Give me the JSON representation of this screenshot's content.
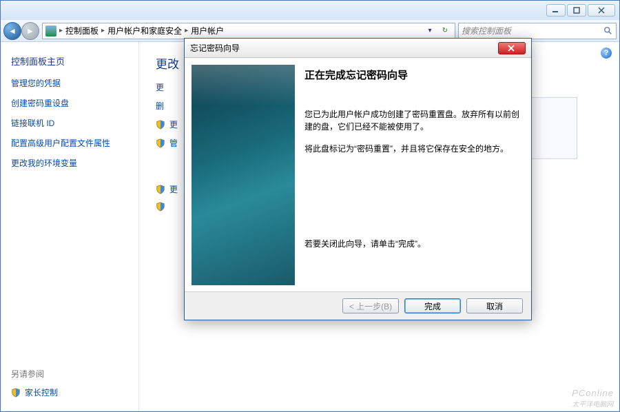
{
  "window": {
    "min_tip": "最小化",
    "max_tip": "最大化",
    "close_tip": "关闭"
  },
  "breadcrumb": {
    "root_icon": "control-panel-icon",
    "items": [
      "控制面板",
      "用户帐户和家庭安全",
      "用户帐户"
    ]
  },
  "search": {
    "placeholder": "搜索控制面板"
  },
  "sidebar": {
    "title": "控制面板主页",
    "links": [
      "管理您的凭据",
      "创建密码重设盘",
      "链接联机 ID",
      "配置高级用户配置文件属性",
      "更改我的环境变量"
    ],
    "see_also": "另请参阅",
    "parental": "家长控制"
  },
  "main": {
    "title_partial": "更改",
    "help_tip": "帮助",
    "items": [
      "更",
      "删",
      "更",
      "管",
      "更"
    ]
  },
  "wizard": {
    "window_title": "忘记密码向导",
    "heading": "正在完成忘记密码向导",
    "p1": "您已为此用户帐户成功创建了密码重置盘。放弃所有以前创建的盘，它们已经不能被使用了。",
    "p2": "将此盘标记为“密码重置”，并且将它保存在安全的地方。",
    "p_end": "若要关闭此向导，请单击“完成”。",
    "back": "< 上一步(B)",
    "finish": "完成",
    "cancel": "取消"
  },
  "watermark": {
    "brand": "PConline",
    "sub": "太平洋电脑网"
  }
}
